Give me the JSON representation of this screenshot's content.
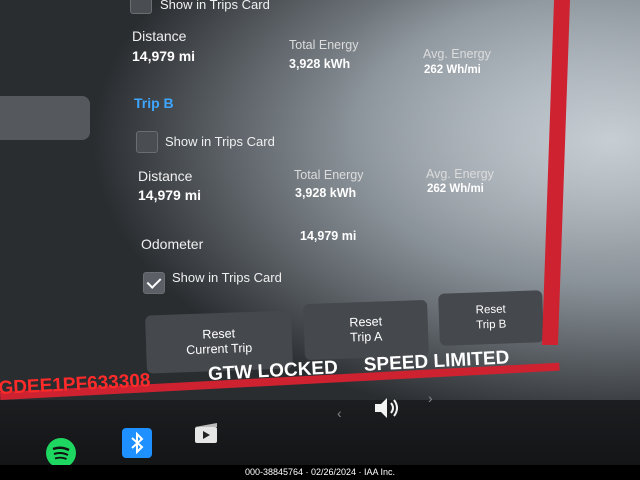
{
  "trip_a": {
    "show_label": "Show in Trips Card",
    "distance_label": "Distance",
    "distance_value": "14,979 mi",
    "energy_label": "Total Energy",
    "energy_value": "3,928 kWh",
    "avg_label": "Avg. Energy",
    "avg_value": "262 Wh/mi"
  },
  "trip_b": {
    "title": "Trip B",
    "show_label": "Show in Trips Card",
    "distance_label": "Distance",
    "distance_value": "14,979 mi",
    "energy_label": "Total Energy",
    "energy_value": "3,928 kWh",
    "avg_label": "Avg. Energy",
    "avg_value": "262 Wh/mi"
  },
  "odometer": {
    "label": "Odometer",
    "value": "14,979 mi",
    "show_label": "Show in Trips Card",
    "show_checked": true
  },
  "buttons": {
    "reset_current_line1": "Reset",
    "reset_current_line2": "Current Trip",
    "reset_a_line1": "Reset",
    "reset_a_line2": "Trip A",
    "reset_b_line1": "Reset",
    "reset_b_line2": "Trip B"
  },
  "status": {
    "vin": "GDEE1PF633308",
    "gtw": "GTW LOCKED",
    "speed": "SPEED LIMITED"
  },
  "taskbar": {
    "icons": [
      "spotify-icon",
      "bluetooth-icon",
      "video-icon",
      "chevron-left-icon",
      "volume-icon",
      "chevron-right-icon"
    ]
  },
  "watermark": "000-38845764 · 02/26/2024 · IAA Inc.",
  "colors": {
    "accent_blue": "#3ea6ff",
    "alert_red": "#ff2a2a",
    "frame_red": "#d6252e",
    "spotify_green": "#1ed760",
    "bluetooth_blue": "#1e90ff"
  }
}
